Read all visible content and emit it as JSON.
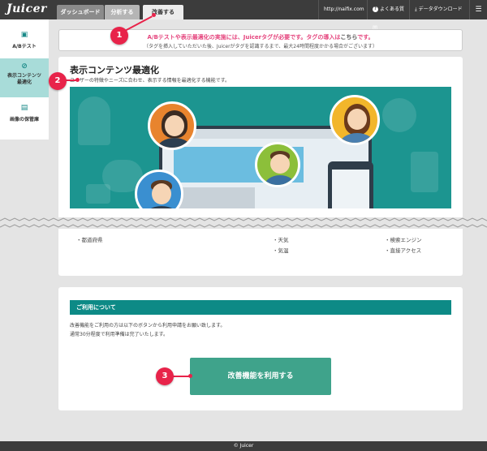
{
  "header": {
    "logo": "Juicer",
    "tabs": [
      {
        "label": "ダッシュボード"
      },
      {
        "label": "分析する"
      },
      {
        "label": "改善する"
      }
    ],
    "url": "http://naifix.com",
    "faq": "よくある質問",
    "download": "データダウンロード",
    "menu_glyph": "☰"
  },
  "sidebar": {
    "items": [
      {
        "label": "A/Bテスト",
        "icon": "ab-test-icon"
      },
      {
        "label_line1": "表示コンテンツ",
        "label_line2": "最適化",
        "icon": "compass-icon"
      },
      {
        "label": "画像の保管庫",
        "icon": "storage-icon"
      }
    ]
  },
  "notice": {
    "line1_prefix": "A/Bテストや表示最適化の実施には、Juicerタグが必要です。タグの導入は",
    "line1_link": "こちら",
    "line1_suffix": "です。",
    "line2": "（タグを挿入していただいた後、Juicerがタグを認識するまで、最大24時間程度かかる場合がございます）"
  },
  "main": {
    "title": "表示コンテンツ最適化",
    "subtitle": "ユーザーの特徴やニーズに合わせ、表示する情報を最適化する機能です。",
    "list_col1": [
      "・都道府県"
    ],
    "list_col2": [
      "・天気",
      "・気温"
    ],
    "list_col3": [
      "・検索エンジン",
      "・直接アクセス"
    ]
  },
  "usage": {
    "header": "ご利用について",
    "text_line1": "改善機能をご利用の方は以下のボタンから利用申請をお願い致します。",
    "text_line2": "通常30分程度で利用準備は完了いたします。",
    "button": "改善機能を利用する"
  },
  "footer": "© Juicer",
  "callouts": [
    "1",
    "2",
    "3"
  ],
  "colors": {
    "topbar": "#3c3c3c",
    "accent_teal": "#0d8a86",
    "button": "#3fa38b",
    "notice_pink": "#e5447d",
    "callout_red": "#e8234a",
    "sidebar_active": "#a8dcd9"
  }
}
